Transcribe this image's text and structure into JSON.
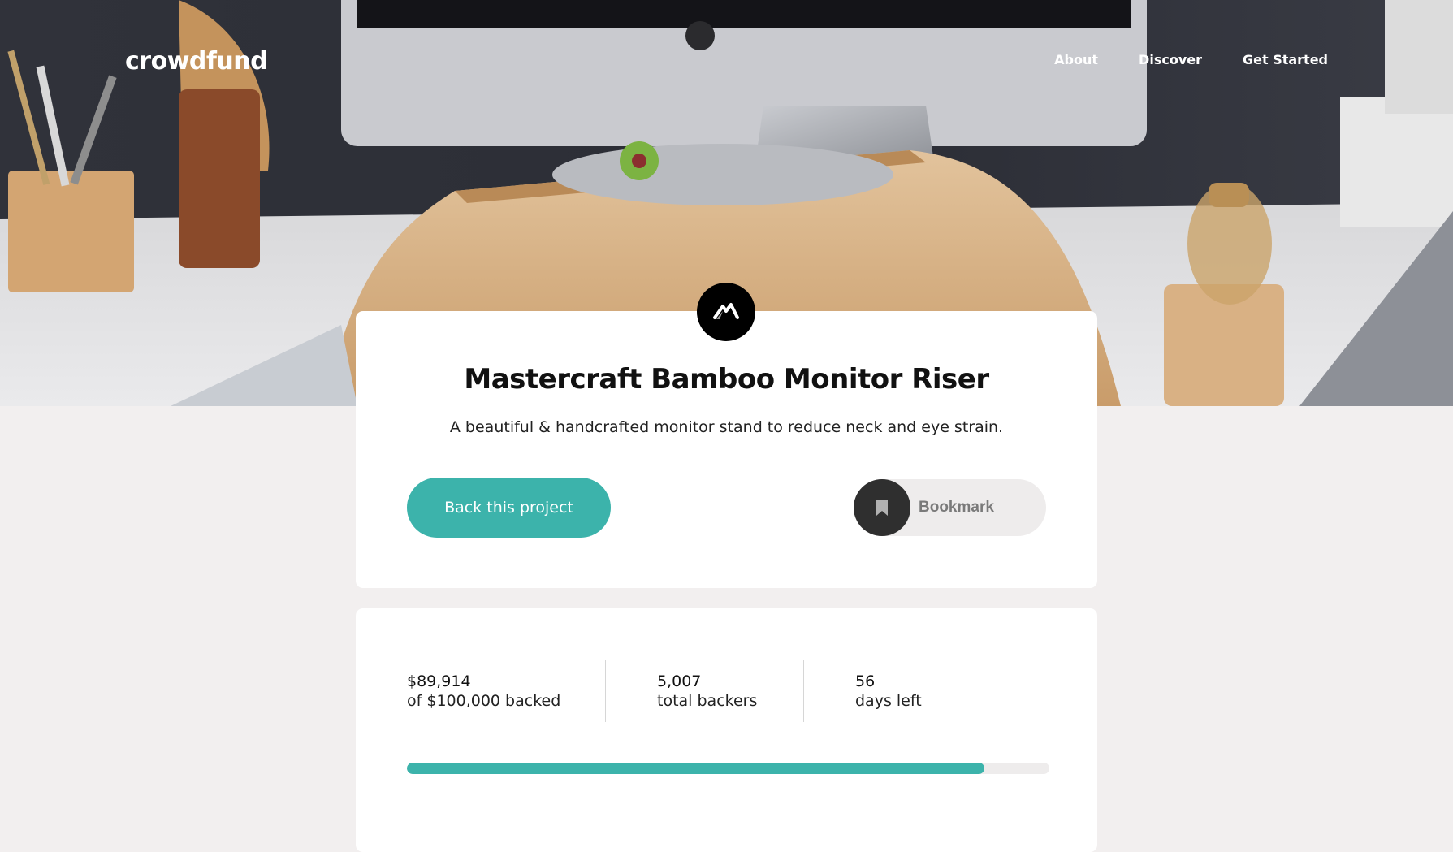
{
  "header": {
    "logo_text": "crowdfund",
    "nav": [
      {
        "label": "About"
      },
      {
        "label": "Discover"
      },
      {
        "label": "Get Started"
      }
    ]
  },
  "project": {
    "title": "Mastercraft Bamboo Monitor Riser",
    "description": "A beautiful & handcrafted monitor stand to reduce neck and eye strain.",
    "back_label": "Back this project",
    "bookmark_label": "Bookmark",
    "logo_icon": "mastercraft-logo-icon",
    "bookmark_icon": "bookmark-icon"
  },
  "stats": {
    "backed": {
      "value": "$89,914",
      "label": "of $100,000 backed"
    },
    "backers": {
      "value": "5,007",
      "label": "total backers"
    },
    "days": {
      "value": "56",
      "label": "days left"
    }
  },
  "progress": {
    "fraction": 0.899
  },
  "colors": {
    "accent": "#3cb3ab",
    "page_bg": "#f2efef",
    "dark": "#2f2f2f"
  }
}
